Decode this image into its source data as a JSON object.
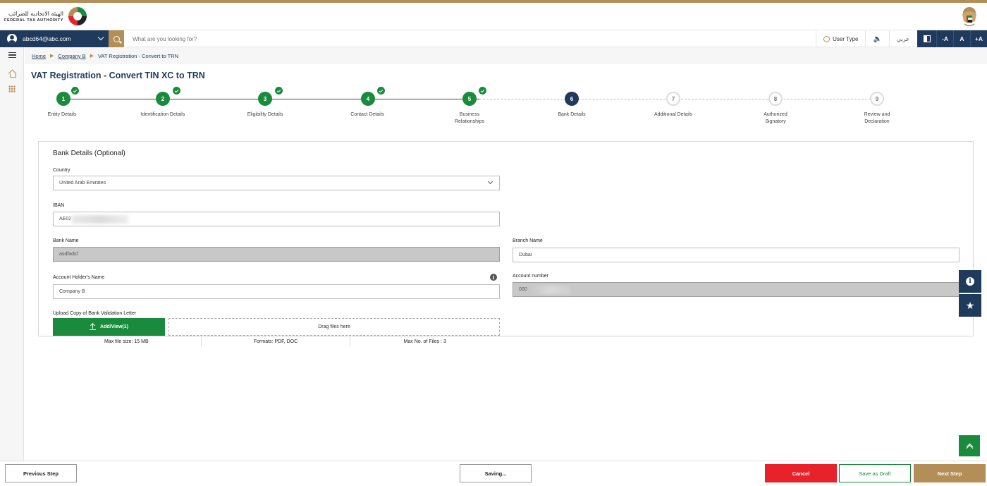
{
  "header": {
    "logo_ar": "الهيئة الاتحادية للضرائب",
    "logo_en": "FEDERAL TAX AUTHORITY"
  },
  "topbar": {
    "user_email": "abcd64@abc.com",
    "search_placeholder": "What are you looking for?",
    "user_type_label": "User Type",
    "speaker_glyph": "🔈",
    "language_label": "عربي",
    "font_decrease": "-A",
    "font_normal": "A",
    "font_increase": "+A"
  },
  "breadcrumb": {
    "home": "Home",
    "company": "Company B",
    "current": "VAT Registration - Convert to TRN",
    "separator": "▶"
  },
  "page_title": "VAT Registration - Convert TIN XC to TRN",
  "steps": [
    {
      "number": "1",
      "label": "Entity Details",
      "status": "done"
    },
    {
      "number": "2",
      "label": "Identification Details",
      "status": "done"
    },
    {
      "number": "3",
      "label": "Eligibility Details",
      "status": "done"
    },
    {
      "number": "4",
      "label": "Contact Details",
      "status": "done"
    },
    {
      "number": "5",
      "label_line1": "Business",
      "label_line2": "Relationships",
      "status": "done"
    },
    {
      "number": "6",
      "label": "Bank Details",
      "status": "current"
    },
    {
      "number": "7",
      "label": "Additional Details",
      "status": "todo"
    },
    {
      "number": "8",
      "label_line1": "Authorized",
      "label_line2": "Signatory",
      "status": "todo"
    },
    {
      "number": "9",
      "label_line1": "Review and",
      "label_line2": "Declaration",
      "status": "todo"
    }
  ],
  "form": {
    "section_title": "Bank Details (Optional)",
    "country_label": "Country",
    "country_value": "United Arab Emirates",
    "iban_label": "IBAN",
    "iban_value": "AE02",
    "bank_name_label": "Bank Name",
    "bank_name_value": "asdfadsf",
    "branch_name_label": "Branch Name",
    "branch_name_value": "Dubai",
    "account_holder_label": "Account Holder's Name",
    "account_holder_value": "Company B",
    "account_number_label": "Account number",
    "account_number_value": "000",
    "upload_label": "Upload Copy of Bank Validation Letter",
    "upload_button": "Add/View(1)",
    "drop_zone": "Drag files here",
    "max_file_size": "Max file size: 15 MB",
    "formats": "Formats: PDF, DOC",
    "max_files": "Max No. of Files : 3"
  },
  "footer": {
    "previous": "Previous Step",
    "saving": "Saving...",
    "cancel": "Cancel",
    "save_draft": "Save as Draft",
    "next": "Next Step"
  },
  "colors": {
    "navy": "#1f3a5c",
    "gold": "#b38e56",
    "green": "#1a8a3c",
    "red": "#e8212b"
  }
}
